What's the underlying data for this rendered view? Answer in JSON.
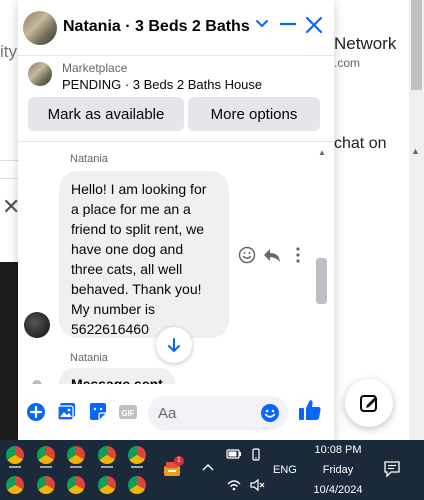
{
  "background": {
    "fragment_ity": "ity",
    "fragment_network": "Network",
    "fragment_com": ".com",
    "fragment_chat_on": "chat on",
    "close_glyph": "✕"
  },
  "chat": {
    "header_title": "Natania · 3 Beds 2 Baths H...",
    "marketplace_label": "Marketplace",
    "listing_title": "PENDING · 3 Beds 2 Baths House",
    "mark_available_label": "Mark as available",
    "more_options_label": "More options",
    "sender_name_1": "Natania",
    "message_1": "Hello! I am looking for a place for me an a friend to split rent, we have one dog and three cats, all well behaved. Thank you! My number is 5622616460",
    "sender_name_2": "Natania",
    "message_2": "Message sent",
    "input_placeholder": "Aa",
    "accent_color": "#0866ff"
  },
  "taskbar": {
    "language": "ENG",
    "time": "10:08 PM",
    "day": "Friday",
    "date": "10/4/2024",
    "notification_badge": "1"
  }
}
